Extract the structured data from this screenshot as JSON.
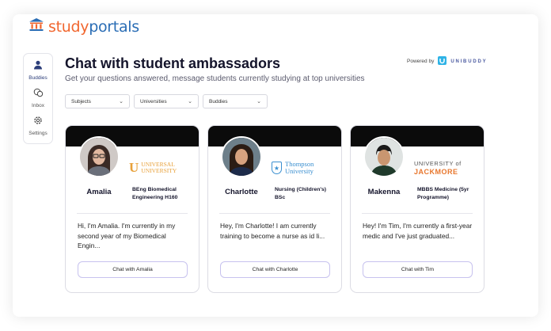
{
  "brand": {
    "name_part1": "study",
    "name_part2": "portals",
    "icon": "institution-icon"
  },
  "sidebar": {
    "items": [
      {
        "label": "Buddies",
        "icon": "person-icon",
        "active": true
      },
      {
        "label": "Inbox",
        "icon": "chat-bubbles-icon",
        "active": false
      },
      {
        "label": "Settings",
        "icon": "gear-icon",
        "active": false
      }
    ]
  },
  "header": {
    "title": "Chat with student ambassadors",
    "subtitle": "Get your questions answered, message students currently studying at top universities",
    "powered_by": "Powered by",
    "powered_brand": "UNIBUDDY"
  },
  "filters": [
    {
      "label": "Subjects"
    },
    {
      "label": "Universities"
    },
    {
      "label": "Buddies"
    }
  ],
  "cards": [
    {
      "name": "Amalia",
      "course": "BEng Biomedical Engineering H160",
      "bio": "Hi, I'm Amalia. I'm currently in my second year of my Biomedical Engin...",
      "button": "Chat with Amalia",
      "university_logo": {
        "line1": "UNIVERSAL",
        "line2": "UNIVERSITY",
        "mark": "U",
        "color": "#e8a13a"
      }
    },
    {
      "name": "Charlotte",
      "course": "Nursing (Children's) BSc",
      "bio": "Hey, I'm Charlotte! I am currently training to become a nurse as id li...",
      "button": "Chat with Charlotte",
      "university_logo": {
        "line1": "Thompson",
        "line2": "University",
        "mark": "★",
        "color": "#3a8fd0"
      }
    },
    {
      "name": "Makenna",
      "course": "MBBS Medicine (5yr Programme)",
      "bio": "Hey! I'm Tim, I'm currently a first-year medic and I've just graduated...",
      "button": "Chat with Tim",
      "university_logo": {
        "line1": "UNIVERSITY of",
        "line2": "JACKMORE",
        "color": "#e8772e"
      }
    }
  ],
  "colors": {
    "brand_orange": "#f1662e",
    "brand_blue": "#2a6db5",
    "accent_navy": "#2c3e7a",
    "button_border": "#c7c2ee"
  }
}
